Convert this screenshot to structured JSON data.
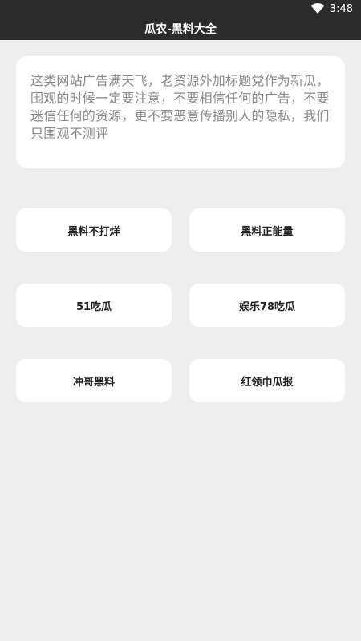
{
  "status_bar": {
    "time": "3:48",
    "icons": [
      "wifi-icon"
    ]
  },
  "app": {
    "title": "瓜农-黑料大全"
  },
  "notice": {
    "text": "这类网站广告满天飞，老资源外加标题党作为新瓜，围观的时候一定要注意，不要相信任何的广告，不要迷信任何的资源，更不要恶意传播别人的隐私，我们只围观不测评"
  },
  "links": [
    {
      "label": "黑料不打烊"
    },
    {
      "label": "黑料正能量"
    },
    {
      "label": "51吃瓜"
    },
    {
      "label": "娱乐78吃瓜"
    },
    {
      "label": "冲哥黑料"
    },
    {
      "label": "红领巾瓜报"
    }
  ],
  "colors": {
    "bar_background": "#2b2b2b",
    "page_background": "#eeeeee",
    "card_background": "#ffffff",
    "notice_text": "#8a8a8a"
  }
}
